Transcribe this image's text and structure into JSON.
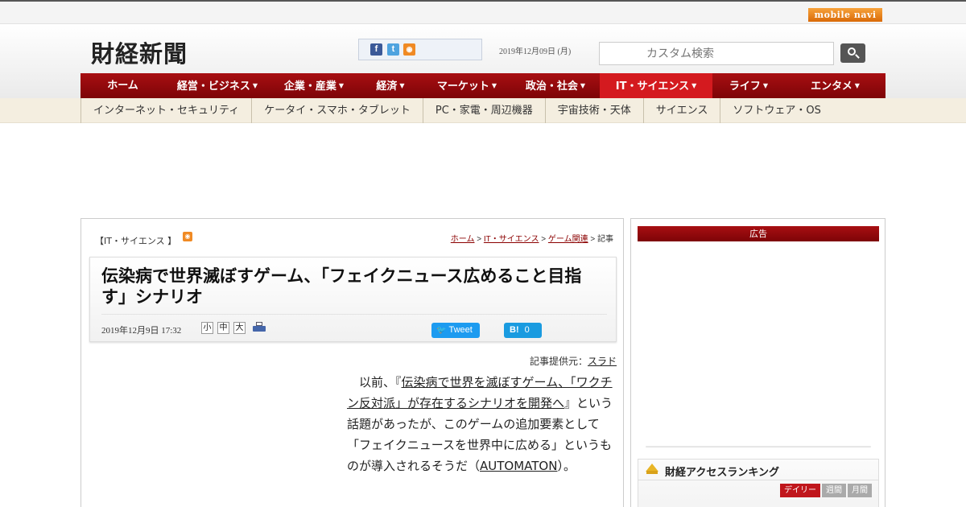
{
  "top": {
    "mobilenavi": "mobile navi"
  },
  "header": {
    "logo": "財経新聞",
    "date": "2019年12月09日 (月)",
    "search_placeholder": "カスタム検索",
    "social": {
      "fb": "f",
      "tw": "t",
      "rss": "◉"
    }
  },
  "nav": {
    "items": [
      {
        "label": "ホーム",
        "caret": ""
      },
      {
        "label": "経営・ビジネス",
        "caret": "▼"
      },
      {
        "label": "企業・産業",
        "caret": "▼"
      },
      {
        "label": "経済",
        "caret": "▼"
      },
      {
        "label": "マーケット",
        "caret": "▼"
      },
      {
        "label": "政治・社会",
        "caret": "▼"
      },
      {
        "label": "IT・サイエンス",
        "caret": "▼"
      },
      {
        "label": "ライフ",
        "caret": "▼"
      },
      {
        "label": "エンタメ",
        "caret": "▼"
      }
    ]
  },
  "subnav": {
    "items": [
      "インターネット・セキュリティ",
      "ケータイ・スマホ・タブレット",
      "PC・家電・周辺機器",
      "宇宙技術・天体",
      "サイエンス",
      "ソフトウェア・OS"
    ]
  },
  "article": {
    "category": "【IT・サイエンス 】",
    "breadcrumb": {
      "home": "ホーム",
      "sep": " > ",
      "cat": "IT・サイエンス",
      "sub": "ゲーム関連",
      "current": "記事"
    },
    "title": "伝染病で世界滅ぼすゲーム、「フェイクニュース広めること目指す」シナリオ",
    "date": "2019年12月9日 17:32",
    "font_sizes": [
      "小",
      "中",
      "大"
    ],
    "tweet": "Tweet",
    "hatena": {
      "label": "B!",
      "count": "0"
    },
    "source_prefix": "記事提供元：",
    "source_name": "スラド",
    "body": {
      "p1_start": "　以前、『",
      "p1_link": "伝染病で世界を滅ぼすゲーム、「ワクチン反対派」が存在するシナリオを開発へ",
      "p1_end": "』という話題があったが、このゲームの追加要素として「フェイクニュースを世界中に広める」というものが導入されるそうだ（",
      "p1_link2": "AUTOMATON",
      "p1_tail": "）。"
    }
  },
  "sidebar": {
    "ad_label": "広告",
    "ranking_title": "財経アクセスランキング",
    "tabs": [
      "デイリー",
      "週間",
      "月間"
    ]
  },
  "colors": {
    "brand_red": "#a80f12",
    "active_red": "#d41a1f"
  }
}
